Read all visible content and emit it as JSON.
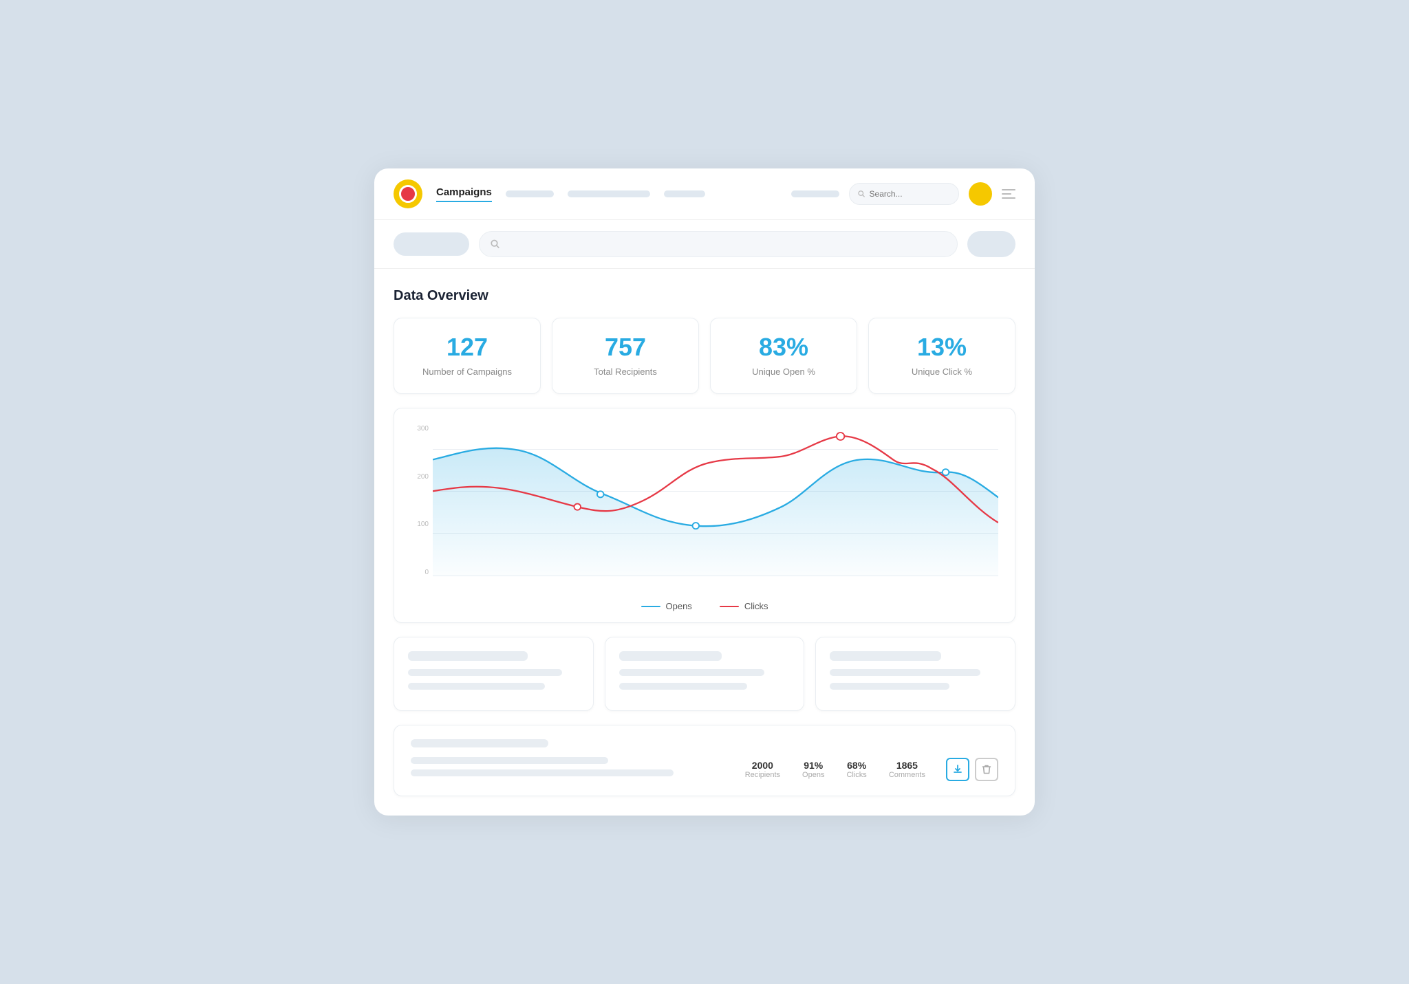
{
  "app": {
    "title": "Campaigns"
  },
  "navbar": {
    "nav_items": [
      "Campaigns",
      "",
      "",
      "",
      ""
    ],
    "search_placeholder": "Search...",
    "active_nav": "Campaigns"
  },
  "toolbar": {
    "btn_label": "",
    "search_placeholder": "",
    "action_label": ""
  },
  "section": {
    "title": "Data Overview"
  },
  "stats": [
    {
      "value": "127",
      "label": "Number of Campaigns"
    },
    {
      "value": "757",
      "label": "Total Recipients"
    },
    {
      "value": "83%",
      "label": "Unique Open %"
    },
    {
      "value": "13%",
      "label": "Unique Click %"
    }
  ],
  "chart": {
    "y_labels": [
      "0",
      "100",
      "200",
      "300"
    ],
    "legend": [
      {
        "label": "Opens",
        "color": "#29abe2"
      },
      {
        "label": "Clicks",
        "color": "#e63946"
      }
    ]
  },
  "table_row": {
    "stats": [
      {
        "value": "2000",
        "label": "Recipients"
      },
      {
        "value": "91%",
        "label": "Opens"
      },
      {
        "value": "68%",
        "label": "Clicks"
      },
      {
        "value": "1865",
        "label": "Comments"
      }
    ],
    "download_icon": "↓",
    "trash_icon": "🗑"
  },
  "colors": {
    "accent": "#29abe2",
    "red": "#e63946",
    "yellow": "#f5c800",
    "bg_light": "#d6e0ea",
    "skel": "#e0e8f0"
  }
}
